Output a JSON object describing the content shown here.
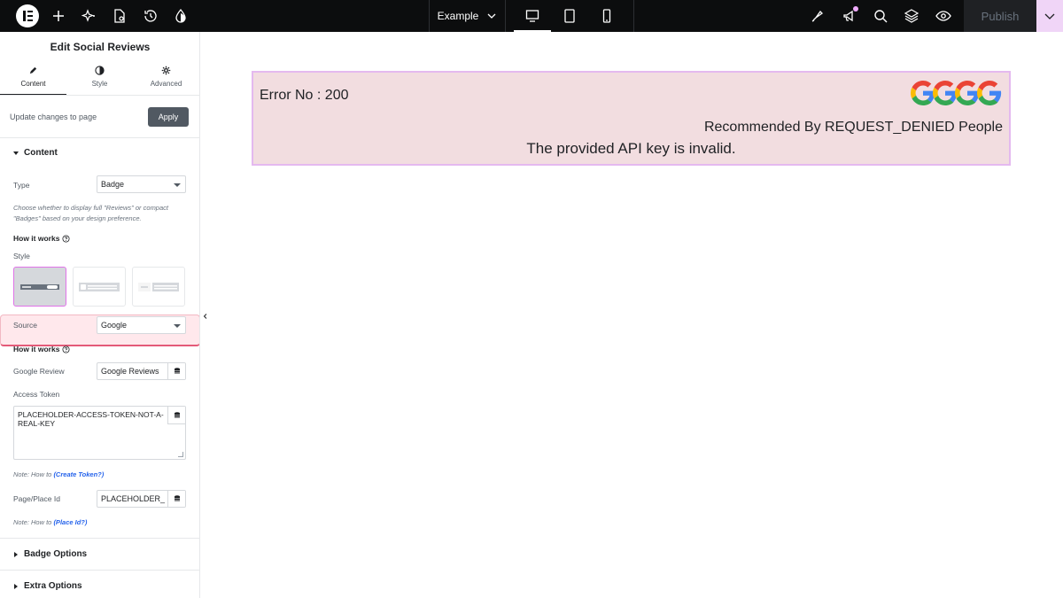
{
  "topbar": {
    "site_name": "Example",
    "publish_label": "Publish",
    "icons": [
      "elementor-logo-icon",
      "add-icon",
      "ai-sparkle-icon",
      "page-settings-icon",
      "history-icon",
      "theme-style-icon",
      "desktop-icon",
      "tablet-icon",
      "mobile-icon",
      "site-settings-icon",
      "whats-new-icon",
      "search-icon",
      "structure-icon",
      "preview-icon",
      "chevron-down-icon"
    ]
  },
  "panel": {
    "title": "Edit Social Reviews",
    "tabs": [
      {
        "label": "Content"
      },
      {
        "label": "Style"
      },
      {
        "label": "Advanced"
      }
    ],
    "update_text": "Update changes to page",
    "apply_label": "Apply",
    "content_section": "Content",
    "type_label": "Type",
    "type_value": "Badge",
    "type_description": "Choose whether to display full \"Reviews\" or compact \"Badges\" based on your design preference.",
    "how_it_works": "How it works",
    "style_label": "Style",
    "source_label": "Source",
    "source_value": "Google",
    "how_it_works_2": "How it works",
    "google_review_label": "Google Review",
    "google_review_value": "Google Reviews",
    "access_token_label": "Access Token",
    "access_token_value": "PLACEHOLDER-ACCESS-TOKEN-NOT-A-REAL-KEY",
    "note_token_prefix": "Note: How to ",
    "note_token_link": "(Create Token?)",
    "place_id_label": "Page/Place Id",
    "place_id_value": "PLACEHOLDER_",
    "note_place_prefix": "Note: How to ",
    "note_place_link": "(Place Id?)",
    "badge_options": "Badge Options",
    "extra_options": "Extra Options"
  },
  "canvas": {
    "error_no": "Error No : 200",
    "recommended": "Recommended By REQUEST_DENIED People",
    "api_message": "The provided API key is invalid.",
    "logo_count": 4
  },
  "colors": {
    "topbar_bg": "#0c0d0e",
    "accent_pink": "#e073e8",
    "widget_bg": "#f2dde0",
    "highlight_border": "#e45a78",
    "link_blue": "#2563eb"
  }
}
